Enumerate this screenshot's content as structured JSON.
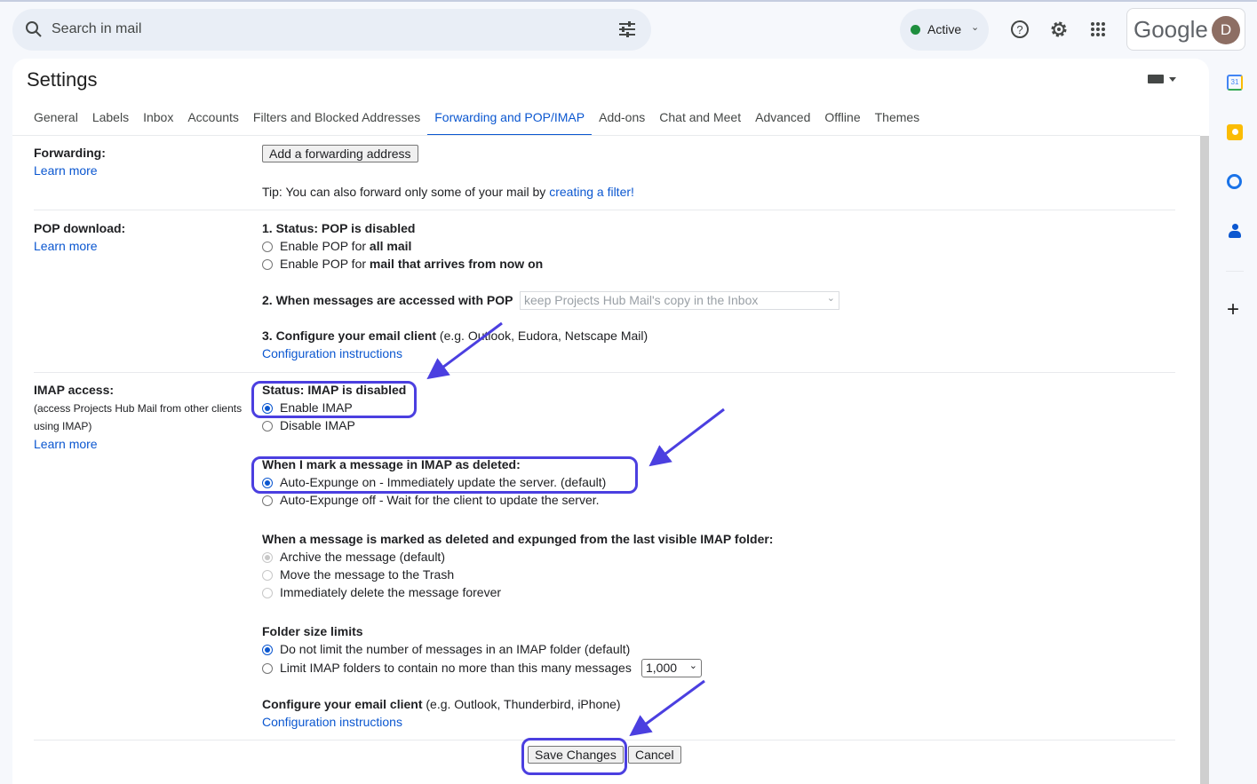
{
  "topbar": {
    "search_placeholder": "Search in mail",
    "status": "Active",
    "brand": "Google",
    "avatar_initial": "D"
  },
  "settings": {
    "title": "Settings",
    "tabs": [
      "General",
      "Labels",
      "Inbox",
      "Accounts",
      "Filters and Blocked Addresses",
      "Forwarding and POP/IMAP",
      "Add-ons",
      "Chat and Meet",
      "Advanced",
      "Offline",
      "Themes"
    ],
    "selected_tab": "Forwarding and POP/IMAP"
  },
  "forwarding": {
    "label": "Forwarding:",
    "learn_more": "Learn more",
    "add_button": "Add a forwarding address",
    "tip": "Tip: You can also forward only some of your mail by ",
    "tip_link": "creating a filter!"
  },
  "pop": {
    "label": "POP download:",
    "learn_more": "Learn more",
    "status": "1. Status: POP is disabled",
    "opt1_pre": "Enable POP for ",
    "opt1_bold": "all mail",
    "opt2_pre": "Enable POP for ",
    "opt2_bold": "mail that arrives from now on",
    "accessed_label": "2. When messages are accessed with POP",
    "accessed_value": "keep Projects Hub Mail's copy in the Inbox",
    "configure_bold": "3. Configure your email client",
    "configure_rest": " (e.g. Outlook, Eudora, Netscape Mail)",
    "config_link": "Configuration instructions"
  },
  "imap": {
    "label": "IMAP access:",
    "sub": "(access Projects Hub Mail from other clients using IMAP)",
    "learn_more": "Learn more",
    "status": "Status: IMAP is disabled",
    "enable": "Enable IMAP",
    "disable": "Disable IMAP",
    "deleted_title": "When I mark a message in IMAP as deleted:",
    "expunge_on": "Auto-Expunge on - Immediately update the server. (default)",
    "expunge_off": "Auto-Expunge off - Wait for the client to update the server.",
    "expunged_title": "When a message is marked as deleted and expunged from the last visible IMAP folder:",
    "archive": "Archive the message (default)",
    "trash": "Move the message to the Trash",
    "delete_forever": "Immediately delete the message forever",
    "folder_title": "Folder size limits",
    "no_limit": "Do not limit the number of messages in an IMAP folder (default)",
    "limit": "Limit IMAP folders to contain no more than this many messages",
    "limit_value": "1,000",
    "configure_bold": "Configure your email client",
    "configure_rest": " (e.g. Outlook, Thunderbird, iPhone)",
    "config_link": "Configuration instructions"
  },
  "footer": {
    "save": "Save Changes",
    "cancel": "Cancel"
  },
  "colors": {
    "accent": "#0b57d0",
    "annotation": "#4b3fe0",
    "active_dot": "#1e8e3e"
  }
}
